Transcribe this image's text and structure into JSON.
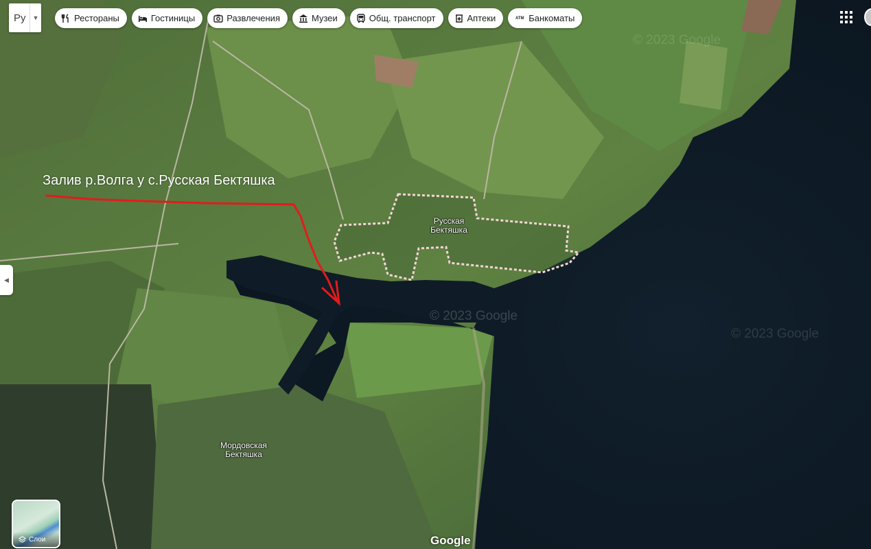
{
  "search": {
    "lang_label": "Ру"
  },
  "chips": [
    {
      "label": "Рестораны",
      "icon": "fork-knife-icon"
    },
    {
      "label": "Гостиницы",
      "icon": "bed-icon"
    },
    {
      "label": "Развлечения",
      "icon": "camera-icon"
    },
    {
      "label": "Музеи",
      "icon": "museum-icon"
    },
    {
      "label": "Общ. транспорт",
      "icon": "bus-icon"
    },
    {
      "label": "Аптеки",
      "icon": "pharmacy-icon"
    },
    {
      "label": "Банкоматы",
      "icon": "atm-icon",
      "icon_text": "ATM"
    }
  ],
  "annotation": {
    "text": "Залив р.Волга у с.Русская Бектяшка",
    "color": "#e31b1b"
  },
  "places": [
    {
      "name": "Русская Бектяшка"
    },
    {
      "name": "Мордовская Бектяшка"
    }
  ],
  "layers": {
    "label": "Слои"
  },
  "watermarks": [
    "© 2023 Google",
    "© 2023 Google",
    "© 2023 Google"
  ],
  "logo": "Google",
  "colors": {
    "water": "#0e1a26",
    "river_arm": "#142029",
    "land_light": "#6c8f4a",
    "land_dark": "#3d5a33",
    "boundary": "#f4d6d6"
  }
}
